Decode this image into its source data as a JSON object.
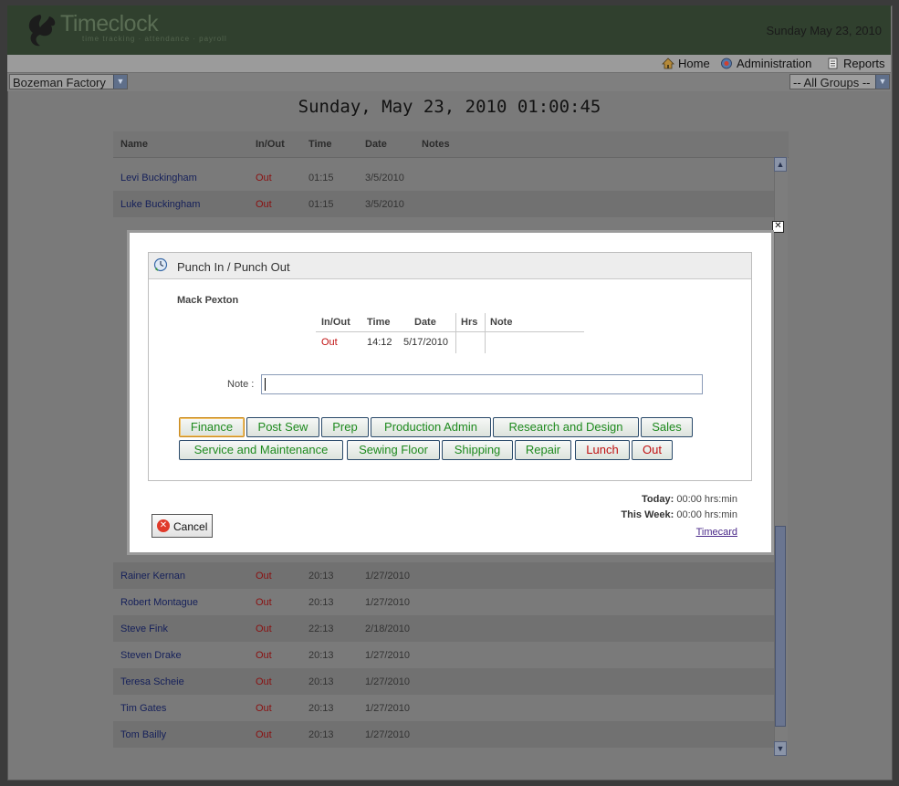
{
  "app": {
    "logo_text": "Timeclock",
    "logo_tagline": "time tracking · attendance · payroll",
    "header_date": "Sunday May 23, 2010"
  },
  "nav": {
    "home": "Home",
    "administration": "Administration",
    "reports": "Reports"
  },
  "location_select": {
    "value": "Bozeman Factory"
  },
  "group_select": {
    "value": "-- All Groups --"
  },
  "page_heading": "Sunday, May 23, 2010 01:00:45",
  "table": {
    "headers": {
      "name": "Name",
      "inout": "In/Out",
      "time": "Time",
      "date": "Date",
      "notes": "Notes"
    },
    "rows_top": [
      {
        "name": "Levi Buckingham",
        "io": "Out",
        "time": "01:15",
        "date": "3/5/2010"
      },
      {
        "name": "Luke Buckingham",
        "io": "Out",
        "time": "01:15",
        "date": "3/5/2010"
      }
    ],
    "rows_bottom": [
      {
        "name": "Rainer Kernan",
        "io": "Out",
        "time": "20:13",
        "date": "1/27/2010"
      },
      {
        "name": "Robert Montague",
        "io": "Out",
        "time": "20:13",
        "date": "1/27/2010"
      },
      {
        "name": "Steve Fink",
        "io": "Out",
        "time": "22:13",
        "date": "2/18/2010"
      },
      {
        "name": "Steven Drake",
        "io": "Out",
        "time": "20:13",
        "date": "1/27/2010"
      },
      {
        "name": "Teresa Scheie",
        "io": "Out",
        "time": "20:13",
        "date": "1/27/2010"
      },
      {
        "name": "Tim Gates",
        "io": "Out",
        "time": "20:13",
        "date": "1/27/2010"
      },
      {
        "name": "Tom Bailly",
        "io": "Out",
        "time": "20:13",
        "date": "1/27/2010"
      }
    ]
  },
  "modal": {
    "title": "Punch In / Punch Out",
    "employee": "Mack Pexton",
    "history_headers": {
      "inout": "In/Out",
      "time": "Time",
      "date": "Date",
      "hrs": "Hrs",
      "note": "Note"
    },
    "history_row": {
      "io": "Out",
      "time": "14:12",
      "date": "5/17/2010",
      "hrs": "",
      "note": ""
    },
    "note_label": "Note :",
    "note_value": "",
    "buttons": [
      "Finance",
      "Post Sew",
      "Prep",
      "Production Admin",
      "Research and Design",
      "Sales",
      "Service and Maintenance",
      "Sewing Floor",
      "Shipping",
      "Repair",
      "Lunch",
      "Out"
    ],
    "cancel": "Cancel",
    "today_label": "Today:",
    "today_value": "00:00 hrs:min",
    "week_label": "This Week:",
    "week_value": "00:00 hrs:min",
    "timecard": "Timecard"
  },
  "colors": {
    "accent_green": "#1e8a1e",
    "accent_red": "#c01010",
    "header_bg": "#30402e"
  }
}
